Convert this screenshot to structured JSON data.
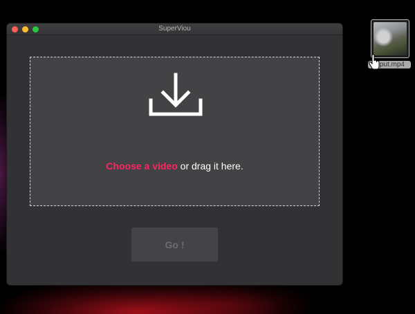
{
  "window": {
    "title": "SuperViou"
  },
  "dropzone": {
    "choose_label": "Choose a video",
    "drag_label": " or drag it here.",
    "icon": "download-icon"
  },
  "go_button": {
    "label": "Go !"
  },
  "desktop": {
    "file_name": "input.mp4"
  },
  "colors": {
    "accent": "#ff2463",
    "window_bg": "#323234",
    "dropzone_bg": "#434244",
    "button_bg": "#444446"
  }
}
